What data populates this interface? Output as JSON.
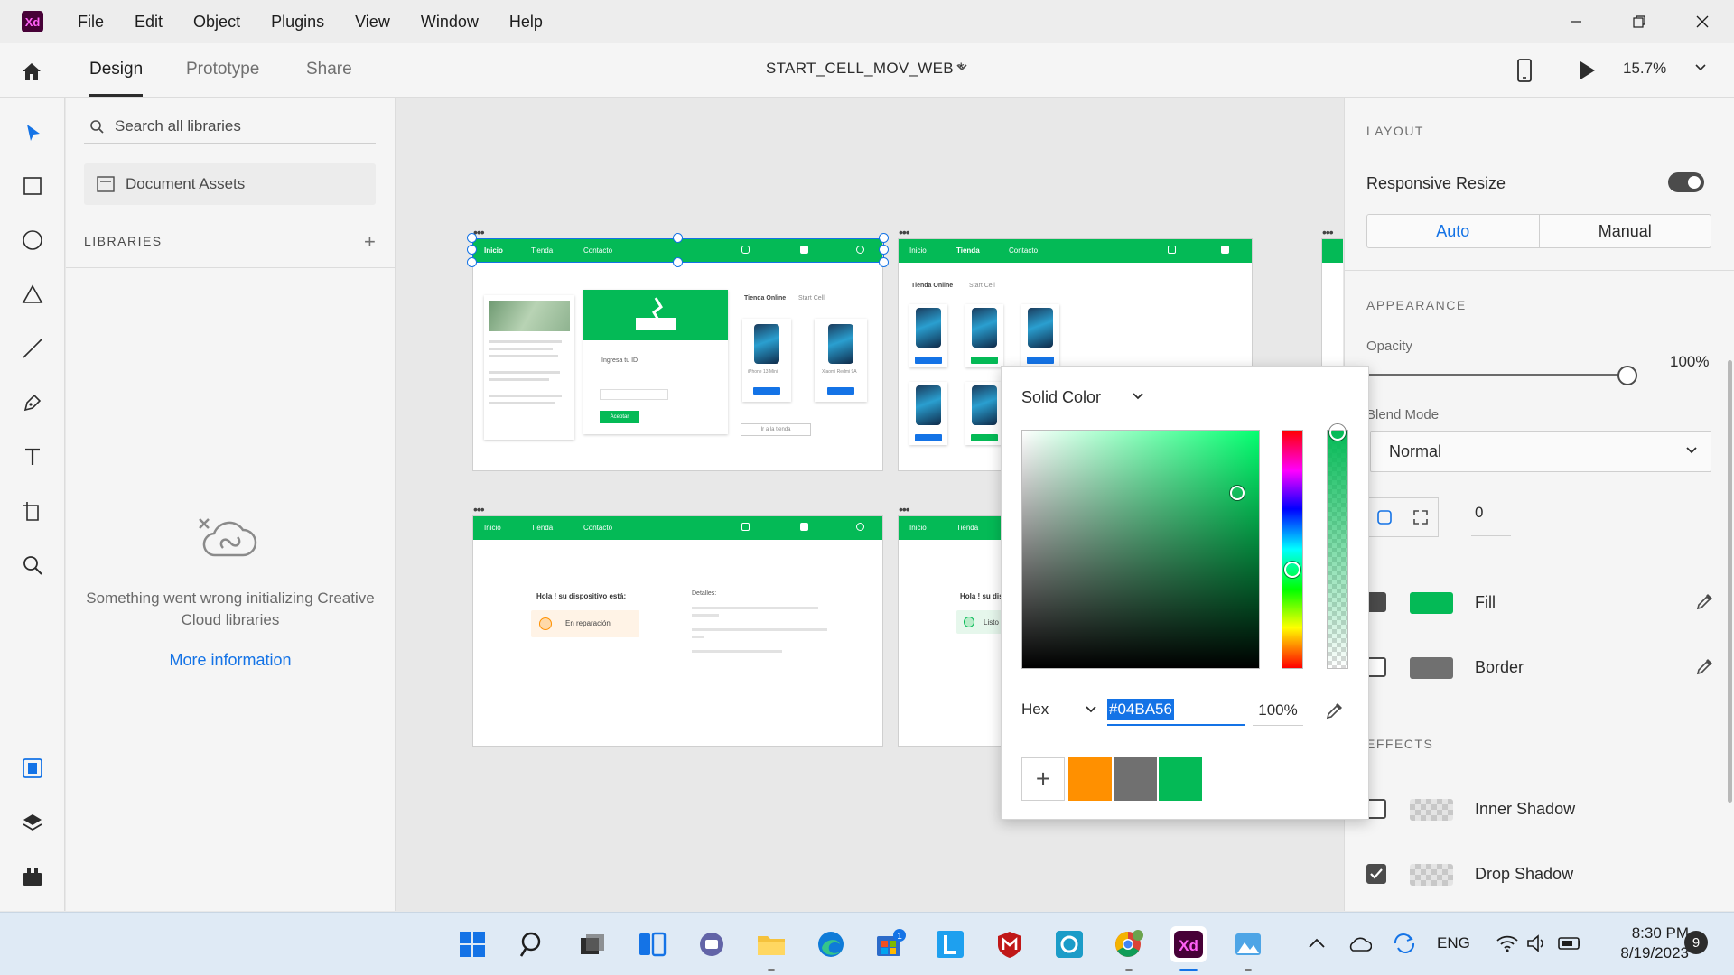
{
  "app": {
    "logo_text": "Xd"
  },
  "menu": [
    "File",
    "Edit",
    "Object",
    "Plugins",
    "View",
    "Window",
    "Help"
  ],
  "tabs": {
    "design": "Design",
    "prototype": "Prototype",
    "share": "Share"
  },
  "document": {
    "title": "START_CELL_MOV_WEB *",
    "zoom": "15.7%"
  },
  "libraries": {
    "search_placeholder": "Search all libraries",
    "document_assets": "Document Assets",
    "heading": "LIBRARIES",
    "error_text": "Something went wrong initializing Creative Cloud libraries",
    "more_info": "More information"
  },
  "artboards": {
    "nav": {
      "home": "Inicio",
      "store": "Tienda",
      "contact": "Contacto"
    },
    "home": {
      "login_title": "Ingresa tu ID",
      "accept": "Aceptar",
      "store_heading": "Tienda Online",
      "store_sub": "Start Cell",
      "phone_a": "iPhone 13 Mini",
      "phone_b": "Xiaomi Redmi 9A",
      "buy": "Ver más",
      "go_store": "Ir a la tienda"
    },
    "status": {
      "greeting": "Hola ! su dispositivo está:",
      "state": "En reparación",
      "details_heading": "Detalles:"
    },
    "status2": {
      "greeting": "Hola ! su dispositivo está:",
      "state": "Listo"
    }
  },
  "properties": {
    "layout_head": "LAYOUT",
    "responsive_resize": "Responsive Resize",
    "responsive_resize_on": true,
    "auto": "Auto",
    "manual": "Manual",
    "appearance_head": "APPEARANCE",
    "opacity_label": "Opacity",
    "opacity_value": "100%",
    "opacity_fraction": 1.0,
    "blend_label": "Blend Mode",
    "blend_value": "Normal",
    "radius_value": "0",
    "fill_label": "Fill",
    "fill_color": "#04BA56",
    "border_label": "Border",
    "border_color": "#707070",
    "effects_head": "EFFECTS",
    "inner_shadow": "Inner Shadow",
    "inner_shadow_on": false,
    "drop_shadow": "Drop Shadow",
    "drop_shadow_on": true
  },
  "color_picker": {
    "type": "Solid Color",
    "mode": "Hex",
    "hex": "#04BA56",
    "alpha": "100%",
    "swatches": [
      "#FF9000",
      "#707070",
      "#04BA56"
    ]
  },
  "taskbar": {
    "lang": "ENG",
    "time": "8:30 PM",
    "date": "8/19/2023",
    "notifications": "9",
    "store_badge": "1"
  },
  "colors": {
    "accent": "#1473E6",
    "brand_green": "#04BA56"
  }
}
